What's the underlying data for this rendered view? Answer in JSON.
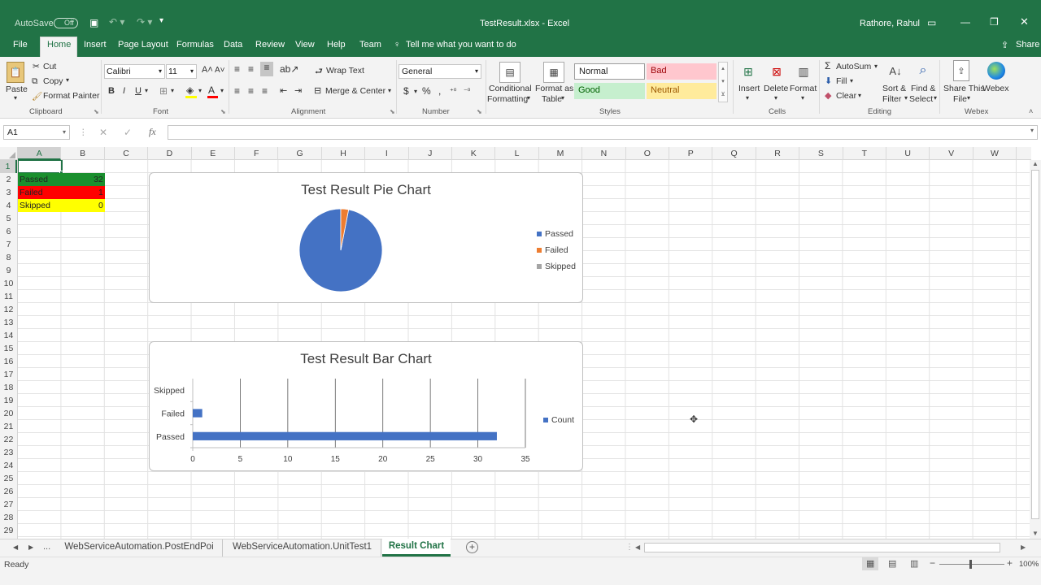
{
  "window": {
    "file_title": "TestResult.xlsx - Excel",
    "autosave": "AutoSave",
    "autosave_state": "Off",
    "user": "Rathore, Rahul"
  },
  "tabs": [
    "File",
    "Home",
    "Insert",
    "Page Layout",
    "Formulas",
    "Data",
    "Review",
    "View",
    "Help",
    "Team"
  ],
  "tell_me": "Tell me what you want to do",
  "share": "Share",
  "ribbon": {
    "clipboard": {
      "paste": "Paste",
      "cut": "Cut",
      "copy": "Copy",
      "format_painter": "Format Painter",
      "label": "Clipboard"
    },
    "font": {
      "name": "Calibri",
      "size": "11",
      "label": "Font"
    },
    "alignment": {
      "wrap": "Wrap Text",
      "merge": "Merge & Center",
      "label": "Alignment"
    },
    "number": {
      "format": "General",
      "label": "Number"
    },
    "styles": {
      "conditional": "Conditional",
      "conditional2": "Formatting",
      "format_as": "Format as",
      "table": "Table",
      "normal": "Normal",
      "bad": "Bad",
      "good": "Good",
      "neutral": "Neutral",
      "label": "Styles"
    },
    "cells": {
      "insert": "Insert",
      "delete": "Delete",
      "format": "Format",
      "label": "Cells"
    },
    "editing": {
      "autosum": "AutoSum",
      "fill": "Fill",
      "clear": "Clear",
      "sort": "Sort &",
      "sort2": "Filter",
      "find": "Find &",
      "find2": "Select",
      "label": "Editing"
    },
    "webex": {
      "share": "Share This",
      "file": "File",
      "webex": "Webex",
      "label": "Webex"
    }
  },
  "namebox": "A1",
  "columns": [
    "A",
    "B",
    "C",
    "D",
    "E",
    "F",
    "G",
    "H",
    "I",
    "J",
    "K",
    "L",
    "M",
    "N",
    "O",
    "P",
    "Q",
    "R",
    "S",
    "T",
    "U",
    "V",
    "W"
  ],
  "rows": [
    "1",
    "2",
    "3",
    "4",
    "5",
    "6",
    "7",
    "8",
    "9",
    "10",
    "11",
    "12",
    "13",
    "14",
    "15",
    "16",
    "17",
    "18",
    "19",
    "20",
    "21",
    "22",
    "23",
    "24",
    "25",
    "26",
    "27",
    "28",
    "29"
  ],
  "data": [
    {
      "label": "Passed",
      "value": "32",
      "color": "#1a8f2e"
    },
    {
      "label": "Failed",
      "value": "1",
      "color": "#ff0000"
    },
    {
      "label": "Skipped",
      "value": "0",
      "color": "#ffff00"
    }
  ],
  "chart_data": [
    {
      "type": "pie",
      "title": "Test Result Pie Chart",
      "categories": [
        "Passed",
        "Failed",
        "Skipped"
      ],
      "values": [
        32,
        1,
        0
      ],
      "colors": [
        "#4472c4",
        "#ed7d31",
        "#a5a5a5"
      ],
      "legend": "right"
    },
    {
      "type": "bar",
      "title": "Test Result Bar Chart",
      "categories": [
        "Passed",
        "Failed",
        "Skipped"
      ],
      "series": [
        {
          "name": "Count",
          "values": [
            32,
            1,
            0
          ]
        }
      ],
      "xlim": [
        0,
        35
      ],
      "xticks": [
        "0",
        "5",
        "10",
        "15",
        "20",
        "25",
        "30",
        "35"
      ],
      "color": "#4472c4",
      "legend": "right",
      "grid": true
    }
  ],
  "sheets": [
    "WebServiceAutomation.PostEndPoi",
    "WebServiceAutomation.UnitTest1",
    "Result Chart"
  ],
  "sheet_nav": "...",
  "status": {
    "ready": "Ready",
    "zoom": "100%"
  }
}
